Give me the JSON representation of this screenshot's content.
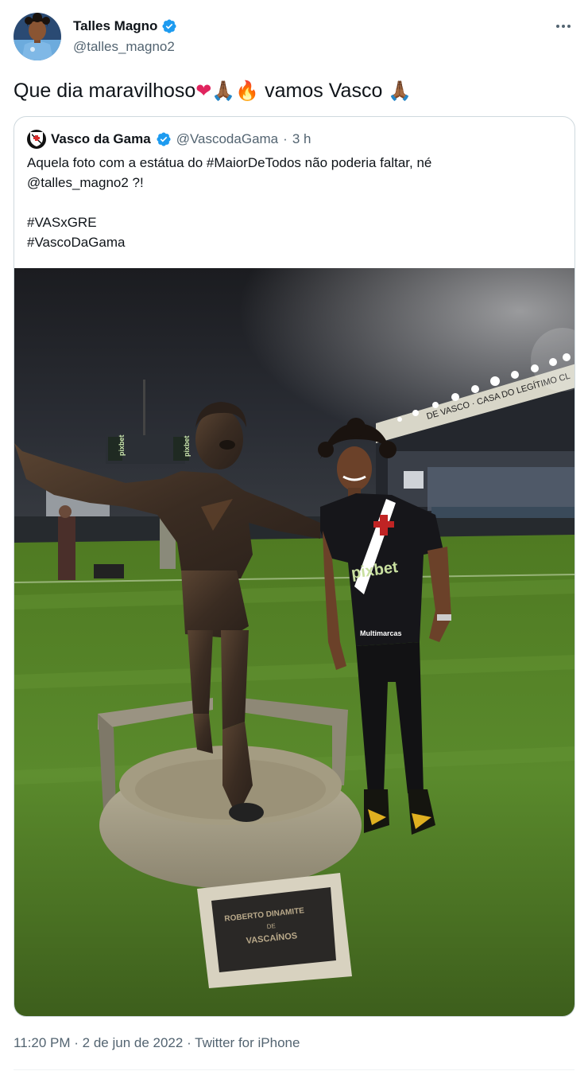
{
  "tweet": {
    "author": {
      "display_name": "Talles Magno",
      "handle": "@talles_magno2",
      "verified": true
    },
    "text_main": "Que dia maravilhoso",
    "emoji_heart": "❤",
    "emoji_hands": "🙏🏾",
    "emoji_fire": "🔥",
    "text_tail": "vamos Vasco",
    "timestamp": "11:20 PM",
    "date": "2 de jun de 2022",
    "source": "Twitter for iPhone",
    "separator": "·"
  },
  "quoted": {
    "display_name": "Vasco da Gama",
    "handle": "@VascodaGama",
    "separator": "·",
    "time_ago": "3 h",
    "lines": [
      "Aquela foto com a estátua do #MaiorDeTodos não poderia faltar, né",
      "@talles_magno2 ?!",
      "",
      "#VASxGRE",
      "#VascoDaGama"
    ],
    "photo": {
      "pitch_board_1": "pixbet",
      "pitch_board_2": "pixbet",
      "stadium_banner": "DE VASCO · CASA DO LEGÍTIMO CL",
      "plaque_name": "ROBERTO DINAMITE",
      "plaque_sub1": "DE",
      "plaque_sub2": "VASCAÍNOS",
      "shirt_sponsor": "pixbet",
      "shirt_sponsor_2": "Multimarcas"
    }
  },
  "colors": {
    "text_primary": "#0f1419",
    "text_secondary": "#536471",
    "verified_blue": "#1d9bf0",
    "border": "#cfd9de"
  },
  "icons": {
    "verified": "verified-badge-icon",
    "more": "more-horizontal-icon"
  }
}
